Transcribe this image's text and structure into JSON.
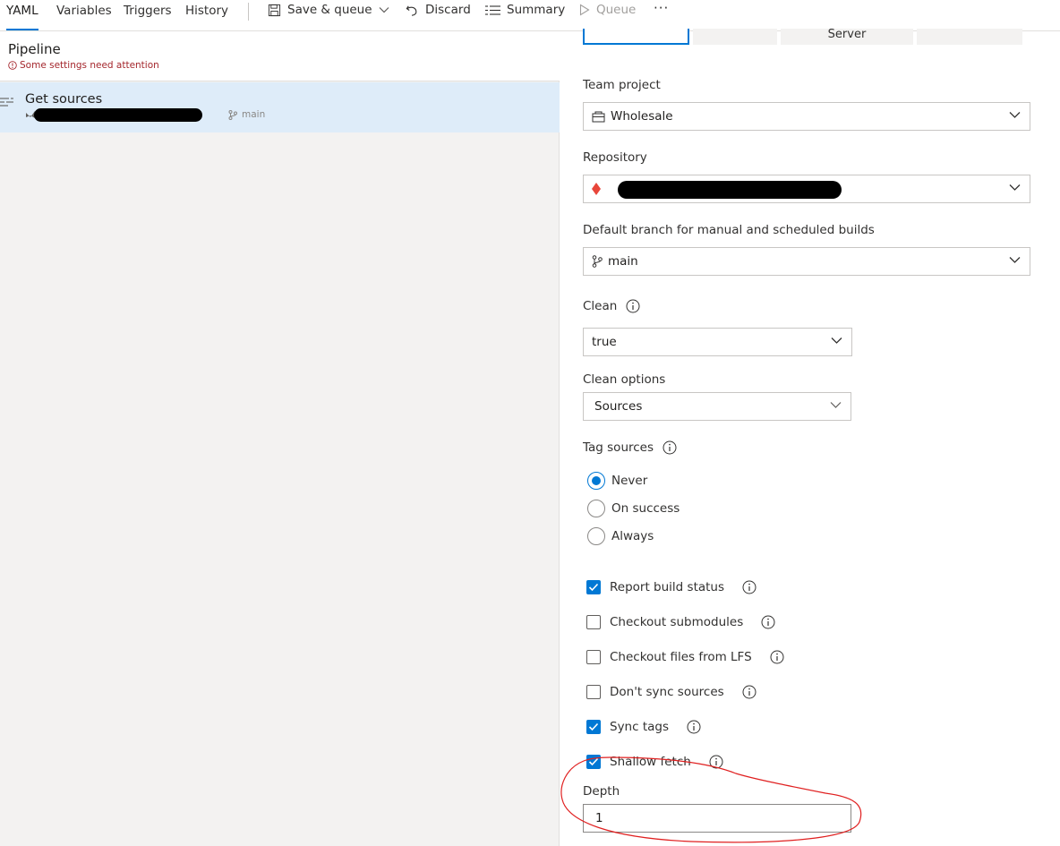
{
  "toolbar": {
    "tabs": [
      "YAML",
      "Variables",
      "Triggers",
      "History"
    ],
    "save_queue": "Save & queue",
    "discard": "Discard",
    "summary": "Summary",
    "queue": "Queue",
    "more": "···"
  },
  "pipeline": {
    "title": "Pipeline",
    "warning": "Some settings need attention"
  },
  "get_sources": {
    "title": "Get sources",
    "branch": "main"
  },
  "agent_tabs": [
    "",
    "",
    "Server",
    ""
  ],
  "form": {
    "team_project_label": "Team project",
    "team_project_value": "Wholesale",
    "repository_label": "Repository",
    "default_branch_label": "Default branch for manual and scheduled builds",
    "default_branch_value": "main",
    "clean_label": "Clean",
    "clean_value": "true",
    "clean_options_label": "Clean options",
    "clean_options_value": "Sources",
    "tag_sources_label": "Tag sources",
    "tag_options": [
      "Never",
      "On success",
      "Always"
    ],
    "tag_selected": "Never",
    "checks": [
      {
        "label": "Report build status",
        "checked": true
      },
      {
        "label": "Checkout submodules",
        "checked": false
      },
      {
        "label": "Checkout files from LFS",
        "checked": false
      },
      {
        "label": "Don't sync sources",
        "checked": false
      },
      {
        "label": "Sync tags",
        "checked": true
      },
      {
        "label": "Shallow fetch",
        "checked": true
      }
    ],
    "depth_label": "Depth",
    "depth_value": "1"
  },
  "colors": {
    "accent": "#0078d4",
    "selected_row": "#deecf9",
    "warning": "#a4262c",
    "annotation": "#e02020"
  }
}
